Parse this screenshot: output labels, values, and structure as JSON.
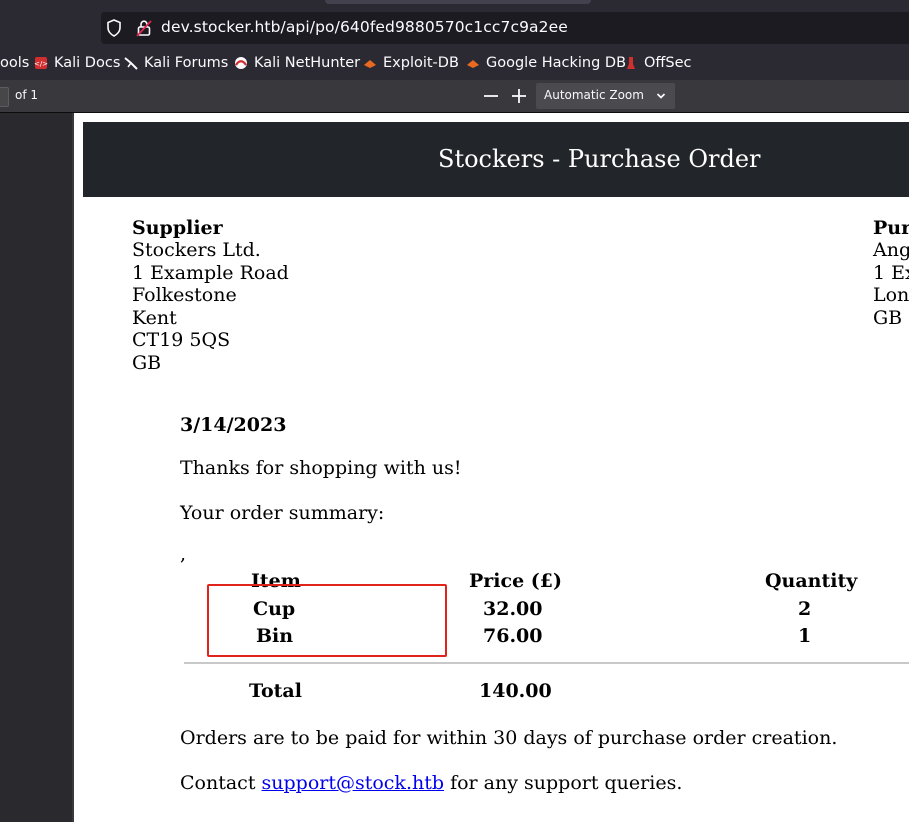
{
  "browser": {
    "url": "dev.stocker.htb/api/po/640fed9880570c1cc7c9a2ee",
    "bookmarks": [
      "ools",
      "Kali Docs",
      "Kali Forums",
      "Kali NetHunter",
      "Exploit-DB",
      "Google Hacking DB",
      "OffSec"
    ]
  },
  "pdf_toolbar": {
    "page_of": "of 1",
    "zoom_out": "−",
    "zoom_in": "+",
    "zoom": "Automatic Zoom"
  },
  "document": {
    "title": "Stockers - Purchase Order",
    "supplier": {
      "heading": "Supplier",
      "lines": [
        "Stockers Ltd.",
        "1 Example Road",
        "Folkestone",
        "Kent",
        "CT19 5QS",
        "GB"
      ]
    },
    "purchaser": {
      "heading": "Purc",
      "lines": [
        "Ango",
        "1 Ex",
        "Lond",
        "GB"
      ]
    },
    "date": "3/14/2023",
    "thanks": "Thanks for shopping with us!",
    "summary_intro": "Your order summary:",
    "stray_char": ",",
    "table": {
      "headers": [
        "Item",
        "Price (£)",
        "Quantity"
      ],
      "rows": [
        {
          "item": "Cup",
          "price": "32.00",
          "qty": "2"
        },
        {
          "item": "Bin",
          "price": "76.00",
          "qty": "1"
        }
      ],
      "total_label": "Total",
      "total_value": "140.00"
    },
    "payment_note": "Orders are to be paid for within 30 days of purchase order creation.",
    "contact_prefix": "Contact",
    "contact_email": "support@stock.htb",
    "contact_suffix": "for any support queries."
  },
  "colors": {
    "header_bg": "#222529",
    "annotation": "#e0241c",
    "link": "#0000ee"
  }
}
